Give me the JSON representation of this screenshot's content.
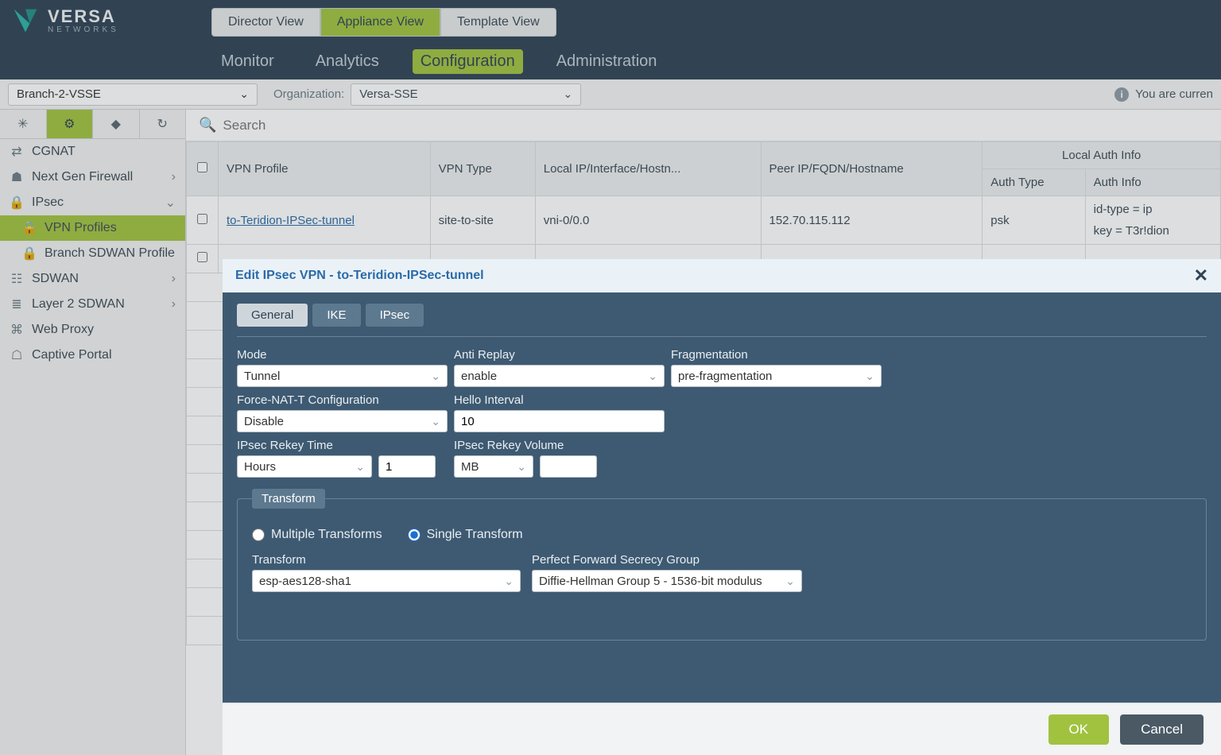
{
  "brand": {
    "name": "VERSA",
    "sub": "NETWORKS"
  },
  "view_tabs": [
    "Director View",
    "Appliance View",
    "Template View"
  ],
  "view_tabs_active": 1,
  "main_tabs": [
    "Monitor",
    "Analytics",
    "Configuration",
    "Administration"
  ],
  "main_tabs_active": 2,
  "context": {
    "appliance": "Branch-2-VSSE",
    "org_label": "Organization:",
    "org": "Versa-SSE",
    "info_text": "You are curren"
  },
  "sidebar": {
    "items": [
      {
        "label": "CGNAT",
        "chev": ""
      },
      {
        "label": "Next Gen Firewall",
        "chev": "›"
      },
      {
        "label": "IPsec",
        "chev": "⌄"
      },
      {
        "label": "VPN Profiles",
        "chev": "",
        "sub": true,
        "active": true
      },
      {
        "label": "Branch SDWAN Profile",
        "chev": "",
        "sub": true
      },
      {
        "label": "SDWAN",
        "chev": "›"
      },
      {
        "label": "Layer 2 SDWAN",
        "chev": "›"
      },
      {
        "label": "Web Proxy",
        "chev": ""
      },
      {
        "label": "Captive Portal",
        "chev": ""
      }
    ]
  },
  "search_placeholder": "Search",
  "table": {
    "headers": {
      "profile": "VPN Profile",
      "type": "VPN Type",
      "local": "Local IP/Interface/Hostn...",
      "peer": "Peer IP/FQDN/Hostname",
      "auth_group": "Local Auth Info",
      "auth_type": "Auth Type",
      "auth_info": "Auth Info"
    },
    "rows": [
      {
        "profile": "to-Teridion-IPSec-tunnel",
        "type": "site-to-site",
        "local": "vni-0/0.0",
        "peer": "152.70.115.112",
        "auth_type": "psk",
        "auth_info_l1": "id-type = ip",
        "auth_info_l2": "key = T3r!dion"
      }
    ]
  },
  "modal": {
    "title": "Edit IPsec VPN - to-Teridion-IPSec-tunnel",
    "tabs": [
      "General",
      "IKE",
      "IPsec"
    ],
    "tabs_active": 2,
    "labels": {
      "mode": "Mode",
      "anti_replay": "Anti Replay",
      "fragmentation": "Fragmentation",
      "force_nat": "Force-NAT-T Configuration",
      "hello": "Hello Interval",
      "rekey_time": "IPsec Rekey Time",
      "rekey_vol": "IPsec Rekey Volume",
      "transform_section": "Transform",
      "multi": "Multiple Transforms",
      "single": "Single Transform",
      "transform": "Transform",
      "pfs": "Perfect Forward Secrecy Group"
    },
    "values": {
      "mode": "Tunnel",
      "anti_replay": "enable",
      "fragmentation": "pre-fragmentation",
      "force_nat": "Disable",
      "hello": "10",
      "rekey_time_unit": "Hours",
      "rekey_time_val": "1",
      "rekey_vol_unit": "MB",
      "rekey_vol_val": "",
      "transform_mode": "single",
      "transform": "esp-aes128-sha1",
      "pfs": "Diffie-Hellman Group 5 - 1536-bit modulus"
    },
    "buttons": {
      "ok": "OK",
      "cancel": "Cancel"
    }
  }
}
